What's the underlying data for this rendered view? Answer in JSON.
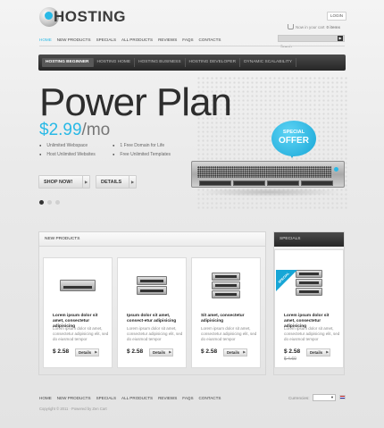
{
  "header": {
    "logo_text": "HOSTING",
    "login_label": "LOGIN",
    "cart_label": "Now in your cart",
    "cart_count": "0 items",
    "search_placeholder": "Search",
    "search_go": "▶"
  },
  "topnav": [
    "HOME",
    "NEW PRODUCTS",
    "SPECIALS",
    "ALL PRODUCTS",
    "REVIEWS",
    "FAQS",
    "CONTACTS"
  ],
  "tabs": [
    "HOSTING BEGINNER",
    "HOSTING HOME",
    "HOSTING BUSINESS",
    "HOSTING DEVELOPER",
    "DYNAMIC SCALABILITY"
  ],
  "hero": {
    "title": "Power Plan",
    "price_amount": "$2.99",
    "price_unit": "/mo",
    "features_left": [
      "Unlimited Webspace",
      "Host Unlimited Websites"
    ],
    "features_right": [
      "1 Free Domain for Life",
      "Free Unlimited Templates"
    ],
    "shop_label": "SHOP NOW!",
    "details_label": "DETAILS",
    "offer_line1": "SPECIAL",
    "offer_line2": "OFFER",
    "slide_count": 3,
    "slide_active": 1
  },
  "new_products": {
    "heading": "NEW PRODUCTS",
    "items": [
      {
        "title": "Lorem ipsum dolor sit amet, consectetur adipisicing",
        "desc": "Lorem ipsum dolor sit amet, consectetur adipisicing elit, sed do eiusmod tempor",
        "price": "$ 2.58",
        "button": "Details"
      },
      {
        "title": "Ipsum dolor sit amet, consect-etur adipisicing",
        "desc": "Lorem ipsum dolor sit amet, consectetur adipisicing elit, sed do eiusmod tempor",
        "price": "$ 2.58",
        "button": "Details"
      },
      {
        "title": "Sit amet, consectetur adipisicing",
        "desc": "Lorem ipsum dolor sit amet, consectetur adipisicing elit, sed do eiusmod tempor",
        "price": "$ 2.58",
        "button": "Details"
      }
    ]
  },
  "specials": {
    "heading": "SPECIALS",
    "ribbon": "SPECIAL",
    "item": {
      "title": "Lorem ipsum dolor sit amet, consectetur adipisicing",
      "desc": "Lorem ipsum dolor sit amet, consectetur adipisicing elit, sed do eiusmod tempor",
      "price": "$ 2.58",
      "old_price": "$ 4.60",
      "button": "Details"
    }
  },
  "footer": {
    "nav": [
      "HOME",
      "NEW PRODUCTS",
      "SPECIALS",
      "ALL PRODUCTS",
      "REVIEWS",
      "FAQS",
      "CONTACTS"
    ],
    "copyright": "Copyright © 2011 · Powered by Zen Cart",
    "currencies_label": "Currencies:",
    "currency_value": ""
  },
  "colors": {
    "accent": "#29b9e6",
    "dark_bar": "#2b2b2b",
    "text": "#333333"
  }
}
